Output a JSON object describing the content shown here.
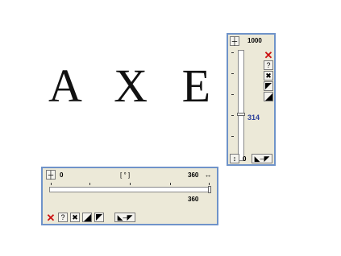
{
  "canvas": {
    "text": "A X E"
  },
  "vertical_panel": {
    "max_label": "1000",
    "min_label": "0",
    "value": "314",
    "value_fraction": 0.314,
    "side_icons": [
      "close-icon",
      "help-icon",
      "tools-icon",
      "scale-icon",
      "triangle-icon"
    ],
    "bottom_icons": [
      "range-icon"
    ]
  },
  "horizontal_panel": {
    "min_label": "0",
    "unit_label": "[ ° ]",
    "max_label": "360",
    "value": "360",
    "value_fraction": 1.0,
    "bottom_icons": [
      "close-icon",
      "help-icon",
      "tools-icon",
      "triangle-icon",
      "scale-icon",
      "range-icon"
    ]
  }
}
